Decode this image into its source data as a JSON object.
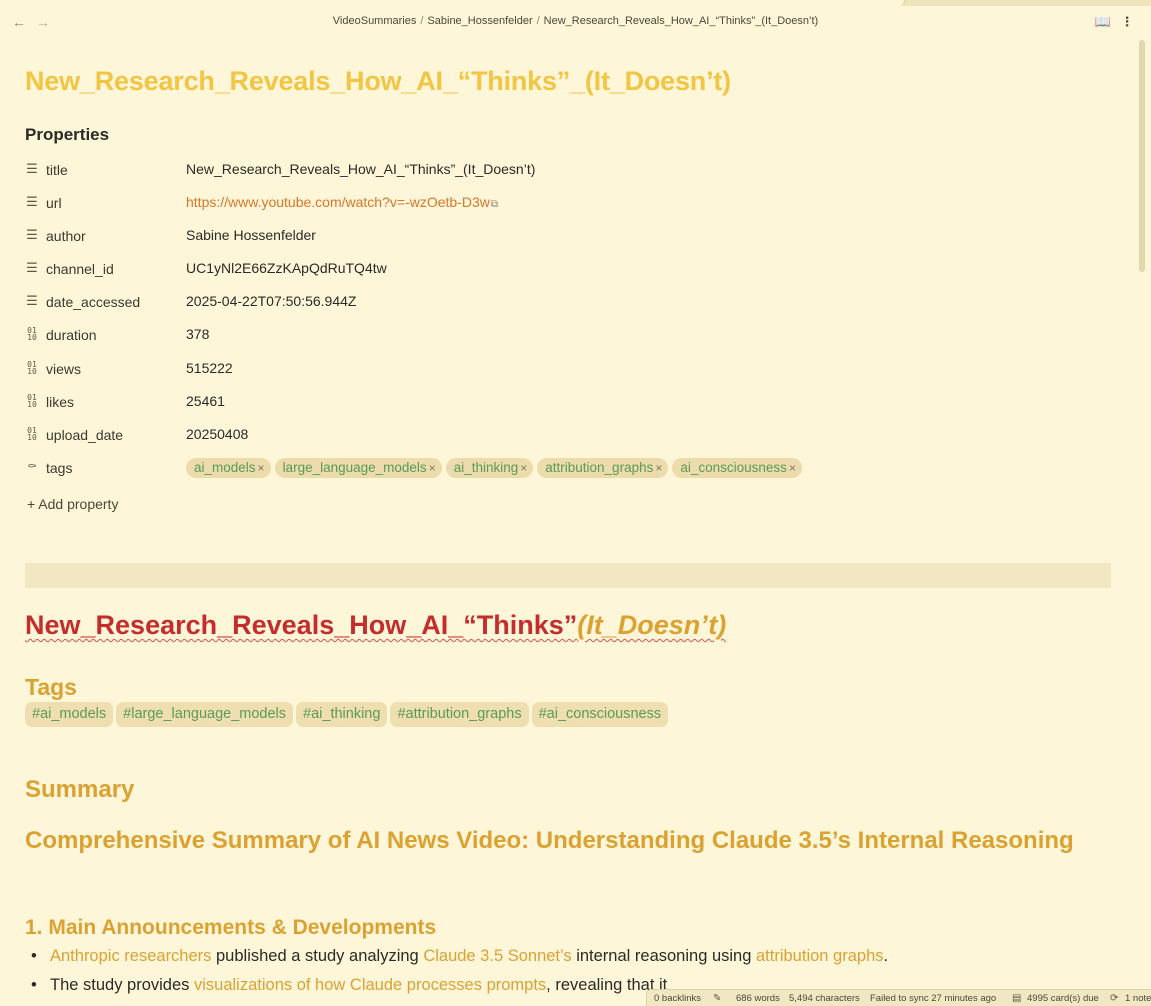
{
  "breadcrumb": [
    "VideoSummaries",
    "Sabine_Hossenfelder",
    "New_Research_Reveals_How_AI_“Thinks”_(It_Doesn’t)"
  ],
  "note": {
    "inline_title": "New_Research_Reveals_How_AI_“Thinks”_(It_Doesn’t)",
    "properties_heading": "Properties",
    "properties": [
      {
        "icon": "text-lines-icon",
        "key": "title",
        "value": "New_Research_Reveals_How_AI_“Thinks”_(It_Doesn’t)"
      },
      {
        "icon": "text-lines-icon",
        "key": "url",
        "value": "https://www.youtube.com/watch?v=-wzOetb-D3w"
      },
      {
        "icon": "text-lines-icon",
        "key": "author",
        "value": "Sabine Hossenfelder"
      },
      {
        "icon": "text-lines-icon",
        "key": "channel_id",
        "value": "UC1yNl2E66ZzKApQdRuTQ4tw"
      },
      {
        "icon": "text-lines-icon",
        "key": "date_accessed",
        "value": "2025-04-22T07:50:56.944Z"
      },
      {
        "icon": "number-icon",
        "key": "duration",
        "value": "378"
      },
      {
        "icon": "number-icon",
        "key": "views",
        "value": "515222"
      },
      {
        "icon": "number-icon",
        "key": "likes",
        "value": "25461"
      },
      {
        "icon": "number-icon",
        "key": "upload_date",
        "value": "20250408"
      }
    ],
    "tags_key": "tags",
    "tags": [
      "ai_models",
      "large_language_models",
      "ai_thinking",
      "attribution_graphs",
      "ai_consciousness"
    ],
    "add_property": "+ Add property"
  },
  "body": {
    "h1_main": "New_Research_Reveals_How_AI_“Thinks”",
    "h1_italic": "(It_Doesn’t)",
    "tags_heading": "Tags",
    "hashtags": [
      "#ai_models",
      "#large_language_models",
      "#ai_thinking",
      "#attribution_graphs",
      "#ai_consciousness"
    ],
    "summary_heading": "Summary",
    "comprehensive_heading": "Comprehensive Summary of AI News Video: Understanding Claude 3.5’s Internal Reasoning",
    "section1_heading": "1. Main Announcements & Developments",
    "bullet1": {
      "hl1": "Anthropic researchers",
      "t1": " published a study analyzing ",
      "hl2": "Claude 3.5 Sonnet’s",
      "t2": " internal reasoning using ",
      "hl3": "attribution graphs",
      "t3": "."
    },
    "bullet2": {
      "t1": "The study provides ",
      "hl1": "visualizations of how Claude processes prompts",
      "t2": ", revealing that it "
    }
  },
  "statusbar": {
    "backlinks": "0 backlinks",
    "words": "686 words",
    "characters": "5,494 characters",
    "sync": "Failed to sync 27 minutes ago",
    "cards_due": "4995 card(s) due",
    "notes": "1 note"
  }
}
